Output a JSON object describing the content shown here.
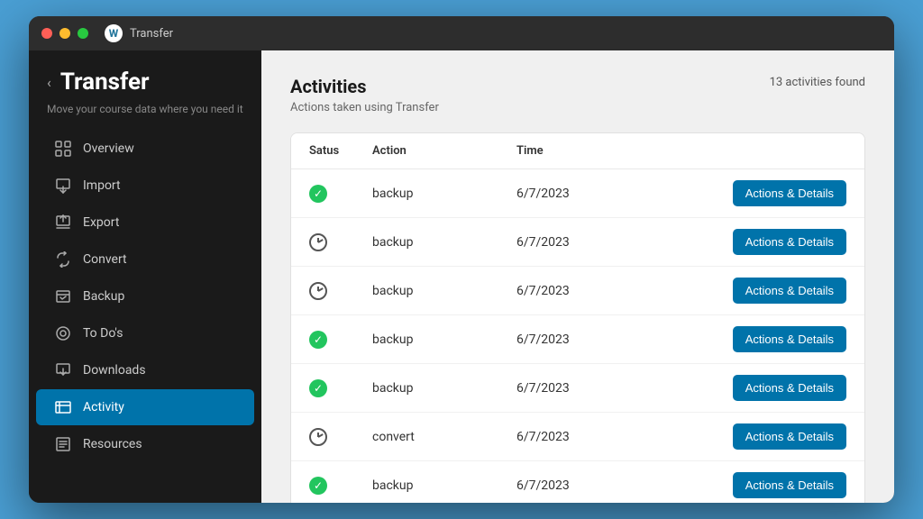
{
  "window": {
    "title": "Transfer"
  },
  "sidebar": {
    "back_label": "‹",
    "title": "Transfer",
    "subtitle": "Move your course data where you need it",
    "items": [
      {
        "id": "overview",
        "label": "Overview",
        "icon": "overview-icon"
      },
      {
        "id": "import",
        "label": "Import",
        "icon": "import-icon"
      },
      {
        "id": "export",
        "label": "Export",
        "icon": "export-icon"
      },
      {
        "id": "convert",
        "label": "Convert",
        "icon": "convert-icon"
      },
      {
        "id": "backup",
        "label": "Backup",
        "icon": "backup-icon"
      },
      {
        "id": "todos",
        "label": "To Do's",
        "icon": "todos-icon"
      },
      {
        "id": "downloads",
        "label": "Downloads",
        "icon": "downloads-icon"
      },
      {
        "id": "activity",
        "label": "Activity",
        "icon": "activity-icon",
        "active": true
      },
      {
        "id": "resources",
        "label": "Resources",
        "icon": "resources-icon"
      }
    ]
  },
  "main": {
    "page_title": "Activities",
    "page_subtitle": "Actions taken using Transfer",
    "activities_count": "13 activities found",
    "table": {
      "columns": [
        "Satus",
        "Action",
        "Time",
        ""
      ],
      "rows": [
        {
          "status": "check",
          "action": "backup",
          "time": "6/7/2023",
          "btn": "Actions & Details"
        },
        {
          "status": "clock",
          "action": "backup",
          "time": "6/7/2023",
          "btn": "Actions & Details"
        },
        {
          "status": "clock",
          "action": "backup",
          "time": "6/7/2023",
          "btn": "Actions & Details"
        },
        {
          "status": "check",
          "action": "backup",
          "time": "6/7/2023",
          "btn": "Actions & Details"
        },
        {
          "status": "check",
          "action": "backup",
          "time": "6/7/2023",
          "btn": "Actions & Details"
        },
        {
          "status": "clock",
          "action": "convert",
          "time": "6/7/2023",
          "btn": "Actions & Details"
        },
        {
          "status": "check",
          "action": "backup",
          "time": "6/7/2023",
          "btn": "Actions & Details"
        }
      ]
    }
  }
}
